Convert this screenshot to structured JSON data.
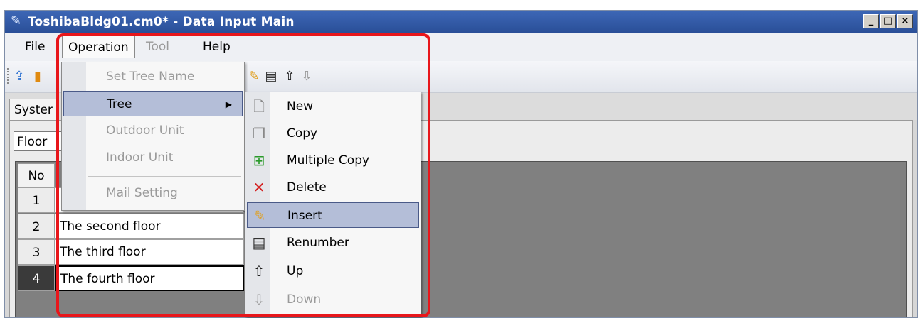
{
  "window": {
    "title": "ToshibaBldg01.cm0* - Data Input Main",
    "controls": [
      "_",
      "□",
      "×"
    ]
  },
  "menubar": {
    "file": "File",
    "operation": "Operation",
    "tool": "Tool",
    "help": "Help"
  },
  "tab": {
    "label": "Syster"
  },
  "combo": {
    "value": "Floor"
  },
  "grid": {
    "no_header": "No",
    "rows": [
      {
        "no": "1",
        "name": ""
      },
      {
        "no": "2",
        "name": "The second floor"
      },
      {
        "no": "3",
        "name": "The third floor"
      },
      {
        "no": "4",
        "name": "The fourth floor"
      }
    ]
  },
  "operation_menu": {
    "items": [
      {
        "label": "Set Tree Name"
      },
      {
        "label": "Tree"
      },
      {
        "label": "Outdoor Unit"
      },
      {
        "label": "Indoor Unit"
      },
      {
        "label": "Mail Setting"
      }
    ]
  },
  "tree_submenu": {
    "items": [
      {
        "label": "New",
        "icon": "new-page-icon"
      },
      {
        "label": "Copy",
        "icon": "copy-icon"
      },
      {
        "label": "Multiple Copy",
        "icon": "multiple-copy-icon"
      },
      {
        "label": "Delete",
        "icon": "delete-x-icon"
      },
      {
        "label": "Insert",
        "icon": "pencil-icon"
      },
      {
        "label": "Renumber",
        "icon": "renumber-icon"
      },
      {
        "label": "Up",
        "icon": "arrow-up-icon"
      },
      {
        "label": "Down",
        "icon": "arrow-down-icon"
      }
    ]
  },
  "colors": {
    "titlebar": "#2a4f98",
    "menu_highlight": "#b4bed8",
    "annotation_frame": "#e8161b"
  }
}
